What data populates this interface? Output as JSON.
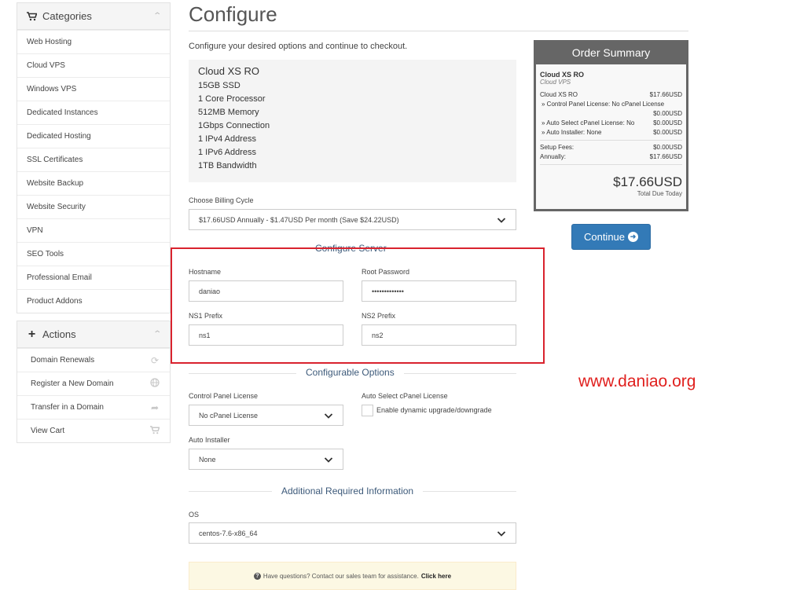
{
  "sidebar": {
    "categories": {
      "title": "Categories",
      "items": [
        {
          "label": "Web Hosting"
        },
        {
          "label": "Cloud VPS"
        },
        {
          "label": "Windows VPS"
        },
        {
          "label": "Dedicated Instances"
        },
        {
          "label": "Dedicated Hosting"
        },
        {
          "label": "SSL Certificates"
        },
        {
          "label": "Website Backup"
        },
        {
          "label": "Website Security"
        },
        {
          "label": "VPN"
        },
        {
          "label": "SEO Tools"
        },
        {
          "label": "Professional Email"
        },
        {
          "label": "Product Addons"
        }
      ]
    },
    "actions": {
      "title": "Actions",
      "items": [
        {
          "label": "Domain Renewals",
          "icon": "refresh-icon"
        },
        {
          "label": "Register a New Domain",
          "icon": "globe-icon"
        },
        {
          "label": "Transfer in a Domain",
          "icon": "share-icon"
        },
        {
          "label": "View Cart",
          "icon": "cart-icon"
        }
      ]
    }
  },
  "main": {
    "title": "Configure",
    "intro": "Configure your desired options and continue to checkout.",
    "product": {
      "name": "Cloud XS RO",
      "features": [
        "15GB SSD",
        "1 Core Processor",
        "512MB Memory",
        "1Gbps Connection",
        "1 IPv4 Address",
        "1 IPv6 Address",
        "1TB Bandwidth"
      ]
    },
    "billing": {
      "label": "Choose Billing Cycle",
      "selected": "$17.66USD Annually - $1.47USD Per month (Save $24.22USD)"
    },
    "configure_server": {
      "title": "Configure Server",
      "hostname_label": "Hostname",
      "hostname_value": "daniao",
      "root_password_label": "Root Password",
      "root_password_value": "•••••••••••••",
      "ns1_label": "NS1 Prefix",
      "ns1_value": "ns1",
      "ns2_label": "NS2 Prefix",
      "ns2_value": "ns2"
    },
    "configurable_options": {
      "title": "Configurable Options",
      "control_panel_label": "Control Panel License",
      "control_panel_value": "No cPanel License",
      "auto_select_label": "Auto Select cPanel License",
      "auto_select_checkbox_label": "Enable dynamic upgrade/downgrade",
      "auto_installer_label": "Auto Installer",
      "auto_installer_value": "None"
    },
    "additional_info": {
      "title": "Additional Required Information",
      "os_label": "OS",
      "os_value": "centos-7.6-x86_64"
    },
    "help": {
      "text": "Have questions? Contact our sales team for assistance.",
      "link": "Click here"
    }
  },
  "summary": {
    "title": "Order Summary",
    "product_name": "Cloud XS RO",
    "product_group": "Cloud VPS",
    "line_product": {
      "label": "Cloud XS RO",
      "price": "$17.66USD"
    },
    "line_control_panel": {
      "label": "» Control Panel License: No cPanel License",
      "price": "$0.00USD"
    },
    "line_auto_select": {
      "label": "» Auto Select cPanel License: No",
      "price": "$0.00USD"
    },
    "line_auto_installer": {
      "label": "» Auto Installer: None",
      "price": "$0.00USD"
    },
    "setup_fees": {
      "label": "Setup Fees:",
      "price": "$0.00USD"
    },
    "annually": {
      "label": "Annually:",
      "price": "$17.66USD"
    },
    "total": "$17.66USD",
    "total_label": "Total Due Today"
  },
  "continue_label": "Continue",
  "watermark": "www.daniao.org",
  "colors": {
    "accent": "#337ab7",
    "summary_header": "#666666",
    "highlight": "#d9232e",
    "section_title": "#3d5a7a",
    "watermark": "#e0201e"
  }
}
